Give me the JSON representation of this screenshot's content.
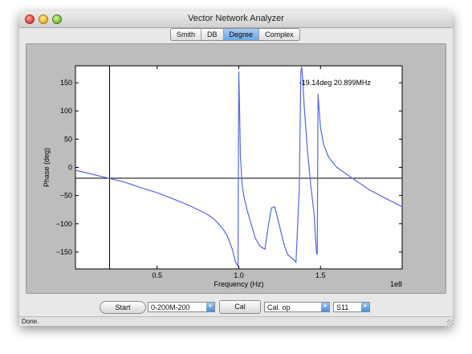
{
  "window": {
    "title": "Vector Network Analyzer"
  },
  "tabs": [
    {
      "label": "Smith",
      "active": false
    },
    {
      "label": "DB",
      "active": false
    },
    {
      "label": "Degree",
      "active": true
    },
    {
      "label": "Complex",
      "active": false
    }
  ],
  "chart_data": {
    "type": "line",
    "xlabel": "Frequency (Hz)",
    "ylabel": "Phase (deg)",
    "x_multiplier_label": "1e8",
    "xlim": [
      0,
      2.0
    ],
    "ylim": [
      -180,
      180
    ],
    "x_ticks": [
      {
        "value": 0.5,
        "label": "0.5"
      },
      {
        "value": 1.0,
        "label": "1.0"
      },
      {
        "value": 1.5,
        "label": "1.5"
      }
    ],
    "y_ticks": [
      {
        "value": 150,
        "label": "150"
      },
      {
        "value": 100,
        "label": "100"
      },
      {
        "value": 50,
        "label": "50"
      },
      {
        "value": 0,
        "label": "0"
      },
      {
        "value": -50,
        "label": "−50"
      },
      {
        "value": -100,
        "label": "−100"
      },
      {
        "value": -150,
        "label": "−150"
      }
    ],
    "grid": false,
    "line_color": "#5566ee",
    "series": [
      {
        "x": [
          0.0,
          0.1,
          0.2,
          0.3,
          0.4,
          0.5,
          0.6,
          0.7,
          0.8,
          0.85,
          0.9,
          0.93,
          0.96,
          0.98,
          0.995,
          1.0,
          1.005,
          1.01,
          1.02,
          1.03,
          1.05,
          1.08,
          1.1,
          1.13,
          1.16,
          1.18,
          1.2,
          1.22,
          1.25,
          1.28,
          1.3,
          1.33,
          1.35,
          1.37,
          1.38,
          1.385,
          1.39,
          1.4,
          1.42,
          1.44,
          1.46,
          1.475,
          1.48,
          1.485,
          1.49,
          1.5,
          1.52,
          1.55,
          1.6,
          1.7,
          1.8,
          1.9,
          2.0
        ],
        "y": [
          -5,
          -12,
          -19,
          -26,
          -36,
          -45,
          -56,
          -68,
          -82,
          -92,
          -108,
          -122,
          -145,
          -168,
          -175,
          170,
          100,
          20,
          -30,
          -50,
          -75,
          -105,
          -125,
          -140,
          -145,
          -105,
          -72,
          -70,
          -105,
          -140,
          -155,
          -162,
          -168,
          -40,
          170,
          178,
          160,
          110,
          30,
          -30,
          -80,
          -150,
          -155,
          130,
          110,
          70,
          40,
          18,
          0,
          -20,
          -40,
          -55,
          -70
        ]
      }
    ],
    "annotation": {
      "text": "-19.14deg 20.899MHz",
      "x": 0.209,
      "y": -19.14
    },
    "crosshair": {
      "x": 0.209,
      "y": -19.14
    }
  },
  "controls": {
    "start_label": "Start",
    "range_value": "0-200M-200",
    "cal_label": "Cal",
    "cal_op_value": "Cal. op",
    "param_value": "S11"
  },
  "status": {
    "text": "Done."
  }
}
